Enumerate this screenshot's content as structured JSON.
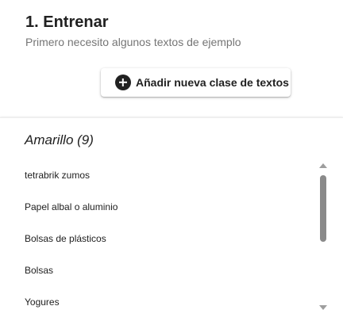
{
  "header": {
    "title": "1. Entrenar",
    "subtitle": "Primero necesito algunos textos de ejemplo"
  },
  "add_button": {
    "icon": "plus-circle-icon",
    "label": "Añadir nueva clase de textos"
  },
  "class_card": {
    "title": "Amarillo (9)",
    "items": [
      "tetrabrik zumos",
      "Papel albal o aluminio",
      "Bolsas de plásticos",
      "Bolsas",
      "Yogures"
    ]
  },
  "colors": {
    "text": "#212121",
    "muted": "#757575",
    "scroll": "#8a8a8a"
  }
}
